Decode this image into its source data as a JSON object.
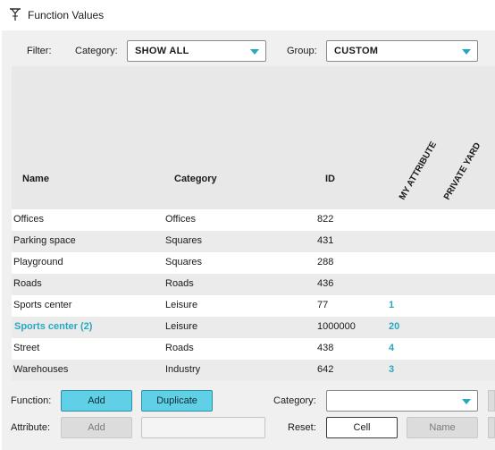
{
  "window": {
    "title": "Function Values",
    "icon": "function-values-icon"
  },
  "filter": {
    "label": "Filter:",
    "category_label": "Category:",
    "category_value": "SHOW ALL",
    "group_label": "Group:",
    "group_value": "CUSTOM"
  },
  "table": {
    "columns": [
      "Name",
      "Category",
      "ID"
    ],
    "rotated_columns": [
      "MY ATTRIBUTE",
      "PRIVATE YARD"
    ],
    "rows": [
      {
        "name": "Offices",
        "category": "Offices",
        "id": "822",
        "my_attribute": ""
      },
      {
        "name": "Parking space",
        "category": "Squares",
        "id": "431",
        "my_attribute": ""
      },
      {
        "name": "Playground",
        "category": "Squares",
        "id": "288",
        "my_attribute": ""
      },
      {
        "name": "Roads",
        "category": "Roads",
        "id": "436",
        "my_attribute": ""
      },
      {
        "name": "Sports center",
        "category": "Leisure",
        "id": "77",
        "my_attribute": "1"
      },
      {
        "name": "Sports center (2)",
        "category": "Leisure",
        "id": "1000000",
        "my_attribute": "20",
        "highlighted": true
      },
      {
        "name": "Street",
        "category": "Roads",
        "id": "438",
        "my_attribute": "4"
      },
      {
        "name": "Warehouses",
        "category": "Industry",
        "id": "642",
        "my_attribute": "3"
      }
    ]
  },
  "bottom": {
    "function_label": "Function:",
    "add_label": "Add",
    "duplicate_label": "Duplicate",
    "category_label": "Category:",
    "category_value": "",
    "attribute_label": "Attribute:",
    "attr_add_label": "Add",
    "attribute_input_value": "",
    "reset_label": "Reset:",
    "cell_label": "Cell",
    "name_label": "Name"
  },
  "colors": {
    "accent": "#2aa7c0",
    "button_primary": "#5fd0e6"
  }
}
